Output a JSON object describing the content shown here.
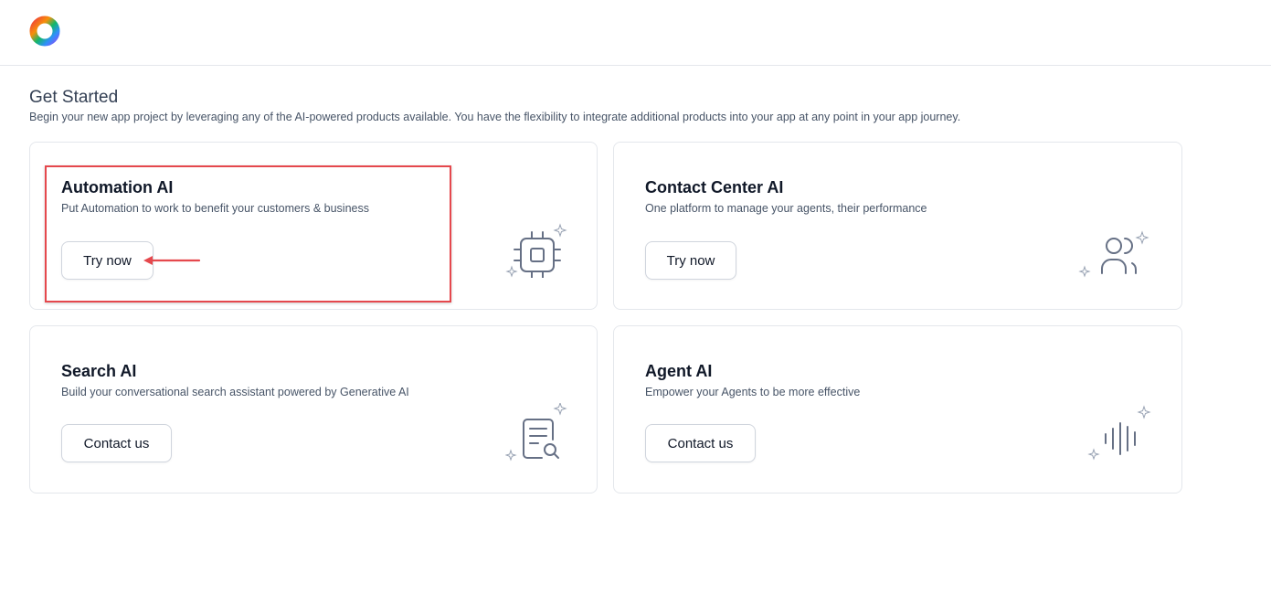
{
  "header": {
    "logo": "product-logo"
  },
  "page": {
    "title": "Get Started",
    "subtitle": "Begin your new app project by leveraging any of the AI-powered products available. You have the flexibility to integrate additional products into your app at any point in your app journey."
  },
  "cards": [
    {
      "title": "Automation AI",
      "description": "Put Automation to work to benefit your customers & business",
      "button": "Try now",
      "icon": "chip-icon"
    },
    {
      "title": "Contact Center AI",
      "description": "One platform to manage your agents, their performance",
      "button": "Try now",
      "icon": "users-icon"
    },
    {
      "title": "Search AI",
      "description": "Build your conversational search assistant powered by Generative AI",
      "button": "Contact us",
      "icon": "document-search-icon"
    },
    {
      "title": "Agent AI",
      "description": "Empower your Agents to be more effective",
      "button": "Contact us",
      "icon": "sound-wave-icon"
    }
  ],
  "colors": {
    "annotation": "#e5484d",
    "card_border": "#e4e7ec",
    "icon_stroke": "#667085"
  }
}
